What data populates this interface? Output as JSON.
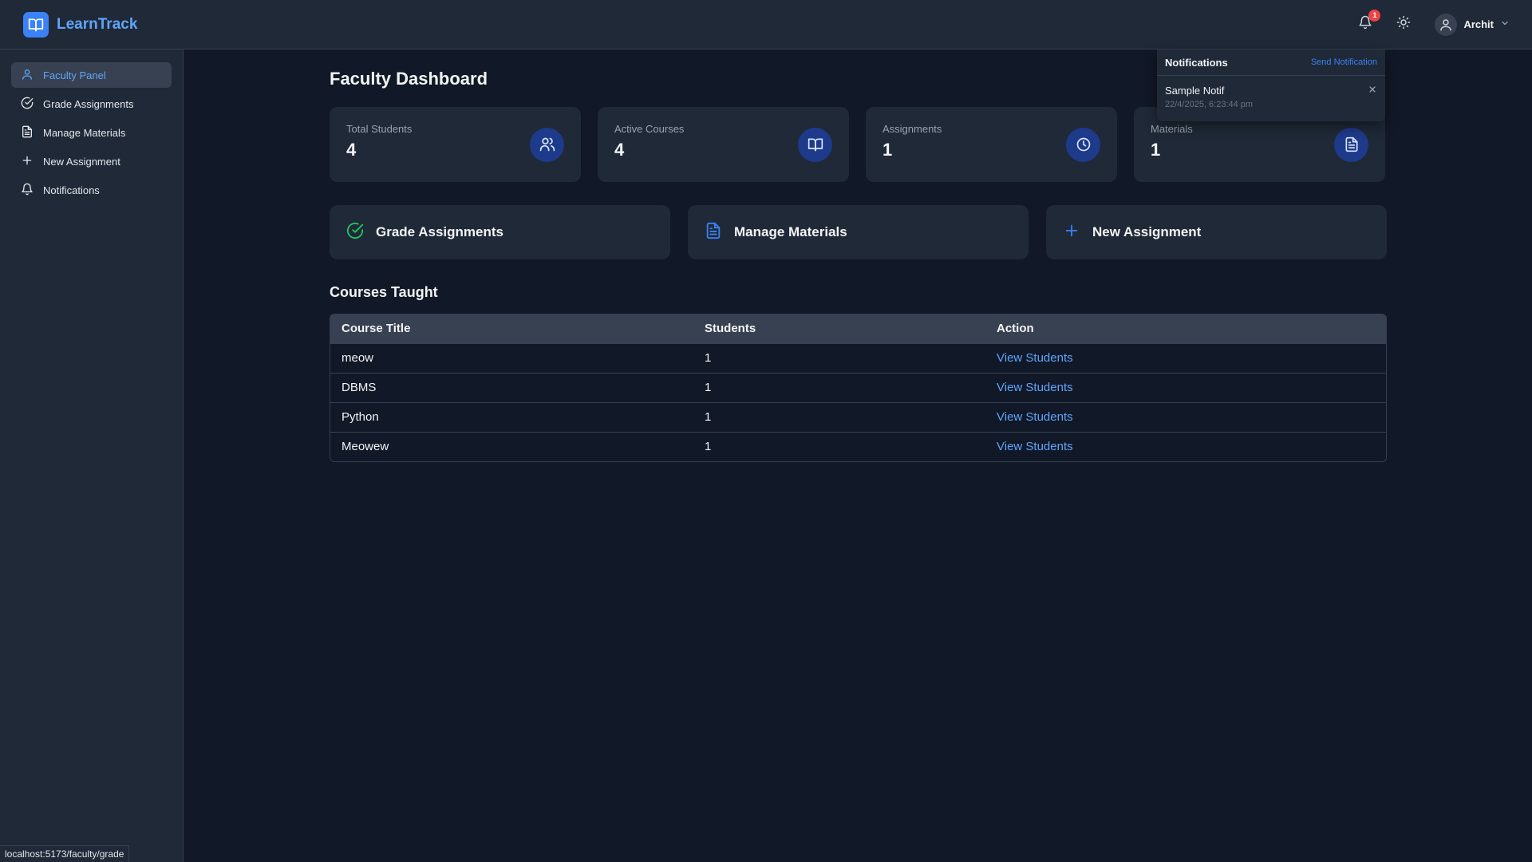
{
  "app": {
    "name": "LearnTrack",
    "logo_icon": "book-open-icon"
  },
  "header": {
    "notification_count": "1",
    "user_name": "Archit"
  },
  "sidebar": {
    "items": [
      {
        "label": "Faculty Panel",
        "icon": "user-icon",
        "active": true
      },
      {
        "label": "Grade Assignments",
        "icon": "check-circle-icon",
        "active": false
      },
      {
        "label": "Manage Materials",
        "icon": "file-text-icon",
        "active": false
      },
      {
        "label": "New Assignment",
        "icon": "plus-icon",
        "active": false
      },
      {
        "label": "Notifications",
        "icon": "bell-icon",
        "active": false
      }
    ]
  },
  "main": {
    "title": "Faculty Dashboard",
    "stats": [
      {
        "label": "Total Students",
        "value": "4",
        "icon": "users-icon"
      },
      {
        "label": "Active Courses",
        "value": "4",
        "icon": "book-open-icon"
      },
      {
        "label": "Assignments",
        "value": "1",
        "icon": "clock-icon"
      },
      {
        "label": "Materials",
        "value": "1",
        "icon": "file-text-icon"
      }
    ],
    "actions": [
      {
        "label": "Grade Assignments",
        "icon": "check-circle-icon",
        "color": "#22c55e"
      },
      {
        "label": "Manage Materials",
        "icon": "file-text-icon",
        "color": "#3b82f6"
      },
      {
        "label": "New Assignment",
        "icon": "plus-icon",
        "color": "#3b82f6"
      }
    ],
    "courses_title": "Courses Taught",
    "table": {
      "headers": [
        "Course Title",
        "Students",
        "Action"
      ],
      "rows": [
        {
          "title": "meow",
          "students": "1",
          "action": "View Students"
        },
        {
          "title": "DBMS",
          "students": "1",
          "action": "View Students"
        },
        {
          "title": "Python",
          "students": "1",
          "action": "View Students"
        },
        {
          "title": "Meowew",
          "students": "1",
          "action": "View Students"
        }
      ]
    }
  },
  "notifications_popup": {
    "title": "Notifications",
    "send_label": "Send Notification",
    "items": [
      {
        "message": "Sample Notif",
        "time": "22/4/2025, 6:23:44 pm"
      }
    ]
  },
  "status_bar": {
    "url": "localhost:5173/faculty/grade"
  },
  "colors": {
    "accent": "#3b82f6",
    "success": "#22c55e",
    "badge": "#ef4444",
    "bg": "#111827",
    "panel": "#1f2937"
  }
}
